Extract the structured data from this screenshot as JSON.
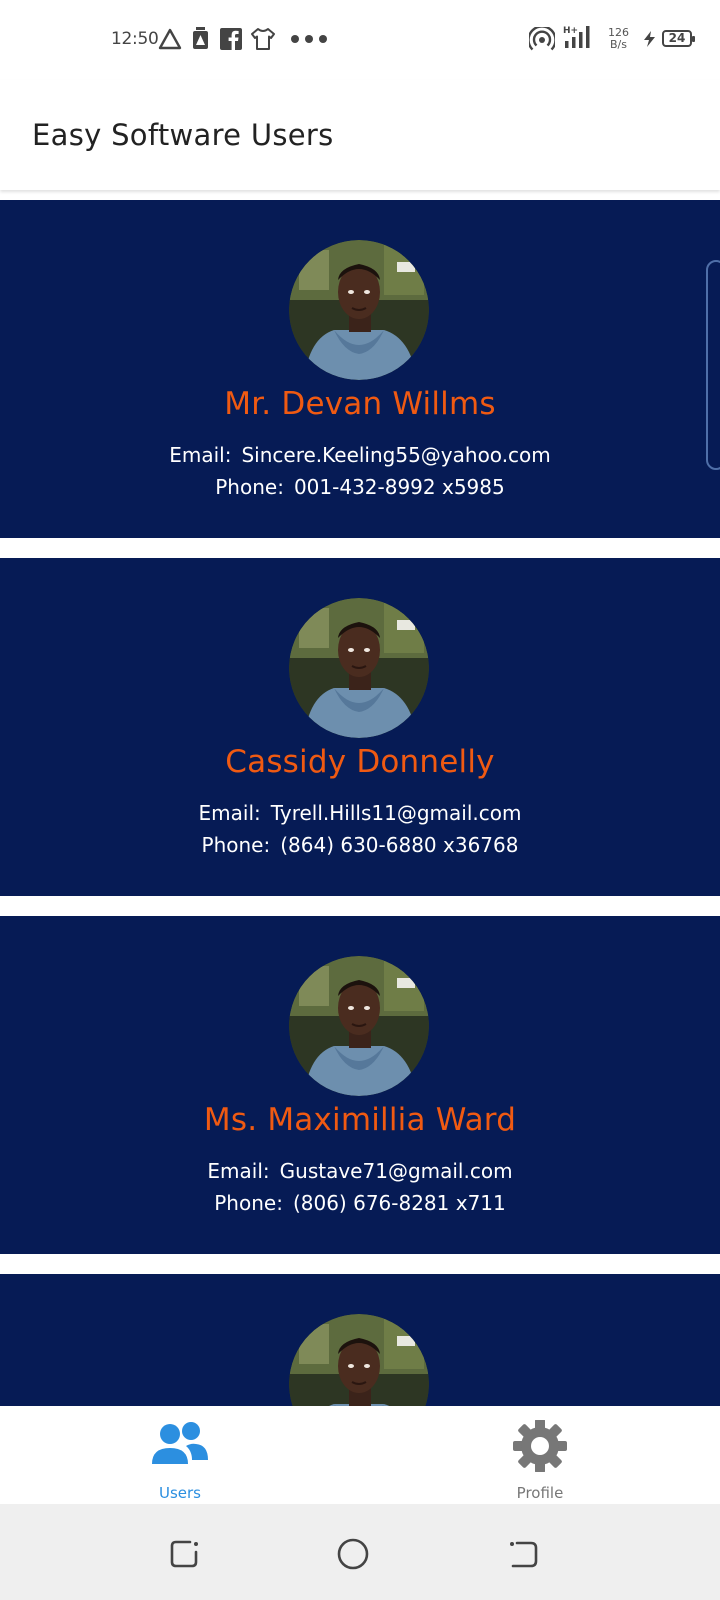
{
  "status_bar": {
    "time": "12:50",
    "network_speed_value": "126",
    "network_speed_unit": "B/s",
    "battery_level": "24",
    "icons": [
      "delta-icon",
      "sim-alert-icon",
      "facebook-icon",
      "tshirt-icon",
      "more-dots-icon",
      "hotspot-icon",
      "signal-icon",
      "charging-icon",
      "battery-icon"
    ]
  },
  "app_bar": {
    "title": "Easy Software Users"
  },
  "user_list": {
    "email_label": "Email:",
    "phone_label": "Phone:",
    "users": [
      {
        "name": "Mr. Devan Willms",
        "email": "Sincere.Keeling55@yahoo.com",
        "phone": "001-432-8992 x5985"
      },
      {
        "name": "Cassidy Donnelly",
        "email": "Tyrell.Hills11@gmail.com",
        "phone": "(864) 630-6880 x36768"
      },
      {
        "name": "Ms. Maximillia Ward",
        "email": "Gustave71@gmail.com",
        "phone": "(806) 676-8281 x711"
      }
    ]
  },
  "bottom_nav": {
    "items": [
      {
        "label": "Users",
        "icon": "users-icon",
        "active": true
      },
      {
        "label": "Profile",
        "icon": "gear-icon",
        "active": false
      }
    ]
  },
  "colors": {
    "card_background": "#061b55",
    "name_color": "#f05a12",
    "active_nav": "#2c8fe0",
    "inactive_nav": "#777777"
  }
}
